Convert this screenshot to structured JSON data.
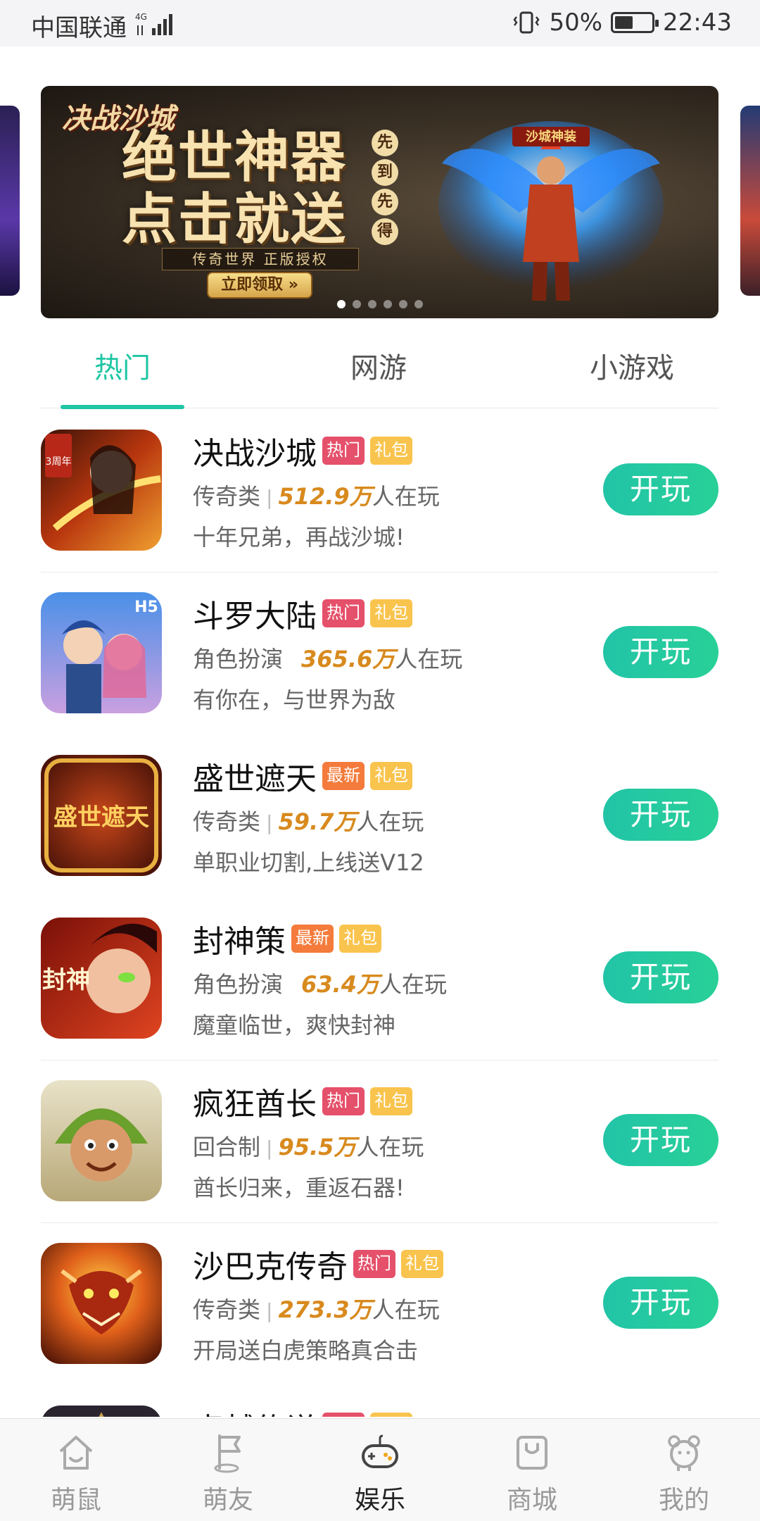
{
  "status_bar": {
    "carrier": "中国联通",
    "network": "4G",
    "battery": "50%",
    "battery_level": 0.5,
    "time": "22:43"
  },
  "banner": {
    "logo": "决战沙城",
    "headline_line1": "绝世神器",
    "headline_line2": "点击就送",
    "stamps": [
      "先",
      "到",
      "先",
      "得"
    ],
    "subline": "传奇世界 正版授权",
    "cta": "立即领取 »",
    "hero_badge": "沙城神装",
    "slide_count": 6,
    "active_slide": 1
  },
  "tabs": [
    {
      "label": "热门",
      "active": true
    },
    {
      "label": "网游",
      "active": false
    },
    {
      "label": "小游戏",
      "active": false
    }
  ],
  "games": [
    {
      "name": "决战沙城",
      "tags": [
        {
          "text": "热门",
          "kind": "hot"
        },
        {
          "text": "礼包",
          "kind": "gift"
        }
      ],
      "category": "传奇类",
      "separator": "|",
      "count": "512.9万",
      "suffix": "人在玩",
      "desc": "十年兄弟，再战沙城!",
      "button": "开玩",
      "icon_text": "3周年"
    },
    {
      "name": "斗罗大陆",
      "tags": [
        {
          "text": "热门",
          "kind": "hot"
        },
        {
          "text": "礼包",
          "kind": "gift"
        }
      ],
      "category": "角色扮演",
      "separator": "",
      "count": "365.6万",
      "suffix": "人在玩",
      "desc": "有你在，与世界为敌",
      "button": "开玩",
      "icon_text": "H5"
    },
    {
      "name": "盛世遮天",
      "tags": [
        {
          "text": "最新",
          "kind": "new"
        },
        {
          "text": "礼包",
          "kind": "gift"
        }
      ],
      "category": "传奇类",
      "separator": "|",
      "count": "59.7万",
      "suffix": "人在玩",
      "desc": "单职业切割,上线送V12",
      "button": "开玩",
      "icon_text": "盛世遮天"
    },
    {
      "name": "封神策",
      "tags": [
        {
          "text": "最新",
          "kind": "new"
        },
        {
          "text": "礼包",
          "kind": "gift"
        }
      ],
      "category": "角色扮演",
      "separator": "",
      "count": "63.4万",
      "suffix": "人在玩",
      "desc": "魔童临世，爽快封神",
      "button": "开玩",
      "icon_text": "封神"
    },
    {
      "name": "疯狂酋长",
      "tags": [
        {
          "text": "热门",
          "kind": "hot"
        },
        {
          "text": "礼包",
          "kind": "gift"
        }
      ],
      "category": "回合制",
      "separator": "|",
      "count": "95.5万",
      "suffix": "人在玩",
      "desc": "酋长归来，重返石器!",
      "button": "开玩",
      "icon_text": ""
    },
    {
      "name": "沙巴克传奇",
      "tags": [
        {
          "text": "热门",
          "kind": "hot"
        },
        {
          "text": "礼包",
          "kind": "gift"
        }
      ],
      "category": "传奇类",
      "separator": "|",
      "count": "273.3万",
      "suffix": "人在玩",
      "desc": "开局送白虎策略真合击",
      "button": "开玩",
      "icon_text": ""
    },
    {
      "name": "卓越传说",
      "tags": [
        {
          "text": "热门",
          "kind": "hot"
        },
        {
          "text": "礼包",
          "kind": "gift"
        }
      ],
      "category": "",
      "separator": "",
      "count": "",
      "suffix": "",
      "desc": "",
      "button": "",
      "icon_text": ""
    }
  ],
  "bottom_nav": [
    {
      "label": "萌鼠",
      "icon": "home-icon",
      "active": false
    },
    {
      "label": "萌友",
      "icon": "flag-icon",
      "active": false
    },
    {
      "label": "娱乐",
      "icon": "gamepad-icon",
      "active": true
    },
    {
      "label": "商城",
      "icon": "shopping-bag-icon",
      "active": false
    },
    {
      "label": "我的",
      "icon": "profile-bear-icon",
      "active": false
    }
  ],
  "colors": {
    "accent": "#1ec6a3",
    "hot_tag": "#e5506a",
    "new_tag": "#f47b3b",
    "gift_tag": "#f9c44d",
    "player_count": "#d88a1e"
  }
}
